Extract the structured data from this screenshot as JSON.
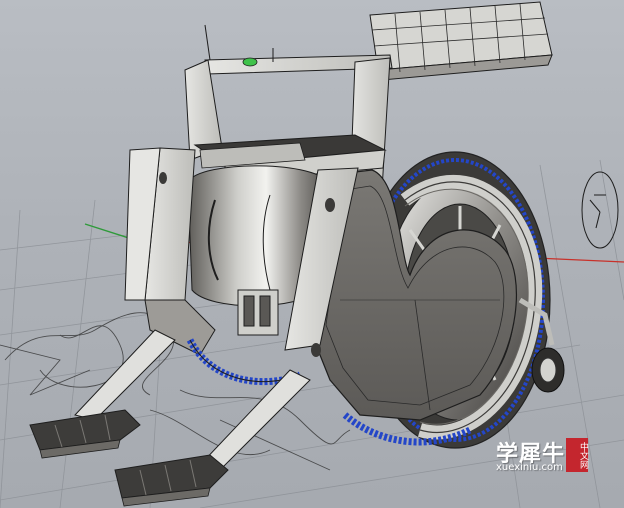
{
  "viewport": {
    "subject": "wireframe-shaded-wheelchair-model",
    "colors": {
      "background": "#aeb2b8",
      "grid": "#8f9399",
      "x_axis": "#c8312a",
      "y_axis": "#2f9a3a",
      "tire_highlight": "#2446c8",
      "body_shade": "#6c6a66",
      "panel_light": "#d9d9d6"
    }
  },
  "watermark": {
    "title": "学犀牛",
    "badge": "中文网",
    "url": "xuexiniu.com"
  }
}
